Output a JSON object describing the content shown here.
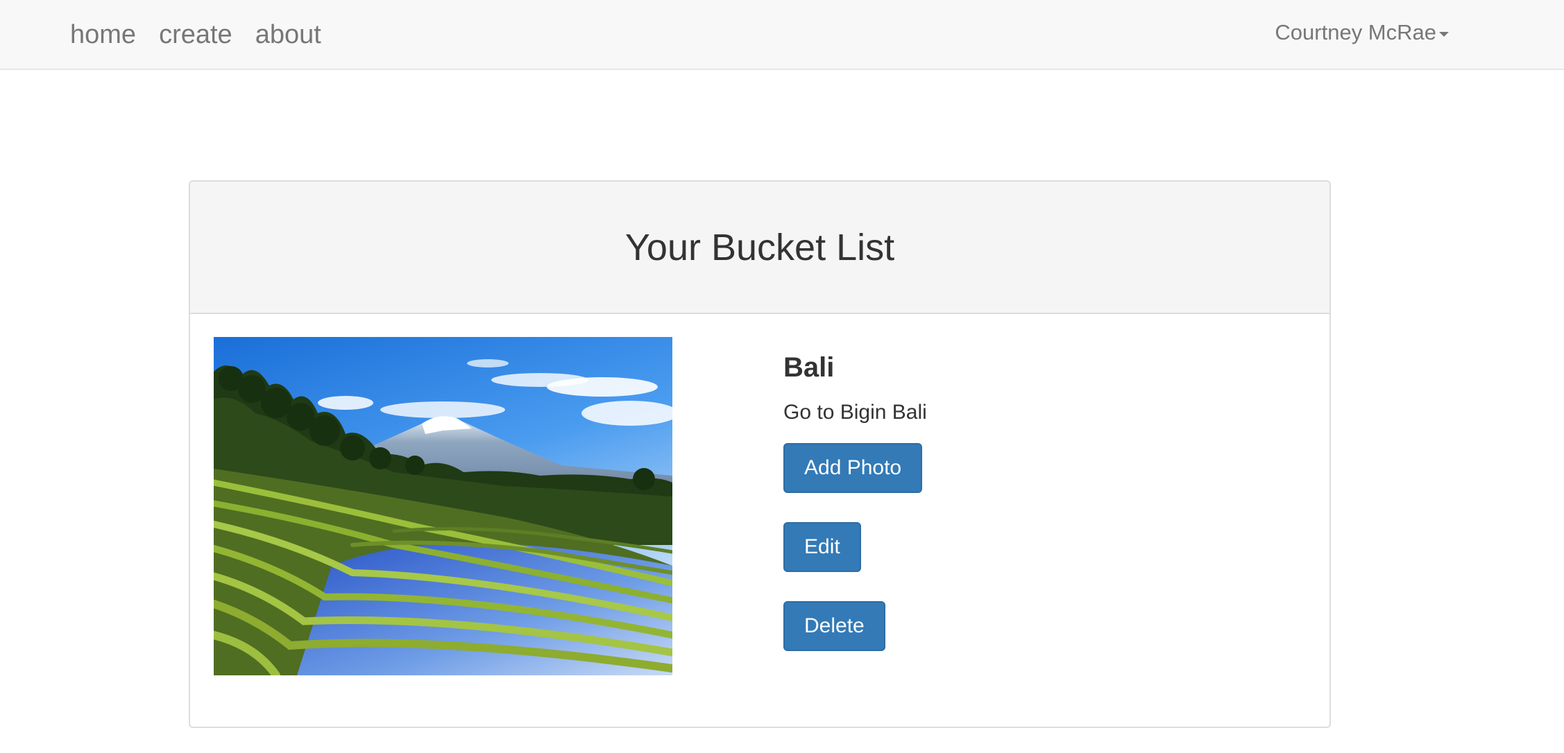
{
  "nav": {
    "links": [
      "home",
      "create",
      "about"
    ],
    "user_name": "Courtney McRae"
  },
  "panel": {
    "title": "Your Bucket List"
  },
  "item": {
    "image_subject": "rice terraces with mountain",
    "title": "Bali",
    "description": "Go to Bigin Bali",
    "buttons": {
      "add_photo": "Add Photo",
      "edit": "Edit",
      "delete": "Delete"
    }
  },
  "colors": {
    "navbar_bg": "#f8f8f8",
    "nav_text": "#777777",
    "panel_heading_bg": "#f5f5f5",
    "button_primary": "#337ab7",
    "text": "#333333"
  }
}
